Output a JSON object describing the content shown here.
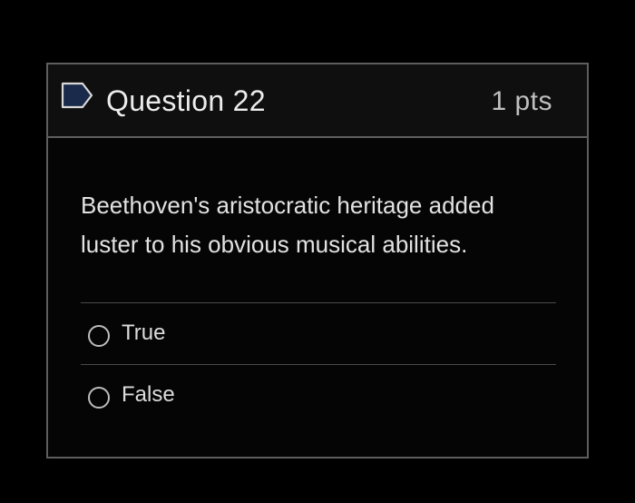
{
  "question": {
    "title": "Question 22",
    "points": "1 pts",
    "flag_icon": "flag-outline-icon",
    "text": "Beethoven's aristocratic heritage added luster to his obvious musical abilities.",
    "answers": [
      {
        "label": "True",
        "selected": false
      },
      {
        "label": "False",
        "selected": false
      }
    ]
  },
  "colors": {
    "background": "#000000",
    "card_border": "#5e5e5e",
    "header_background": "#0f0f0f",
    "text": "#e2e2e2",
    "flag_fill": "#1a2a4a"
  }
}
